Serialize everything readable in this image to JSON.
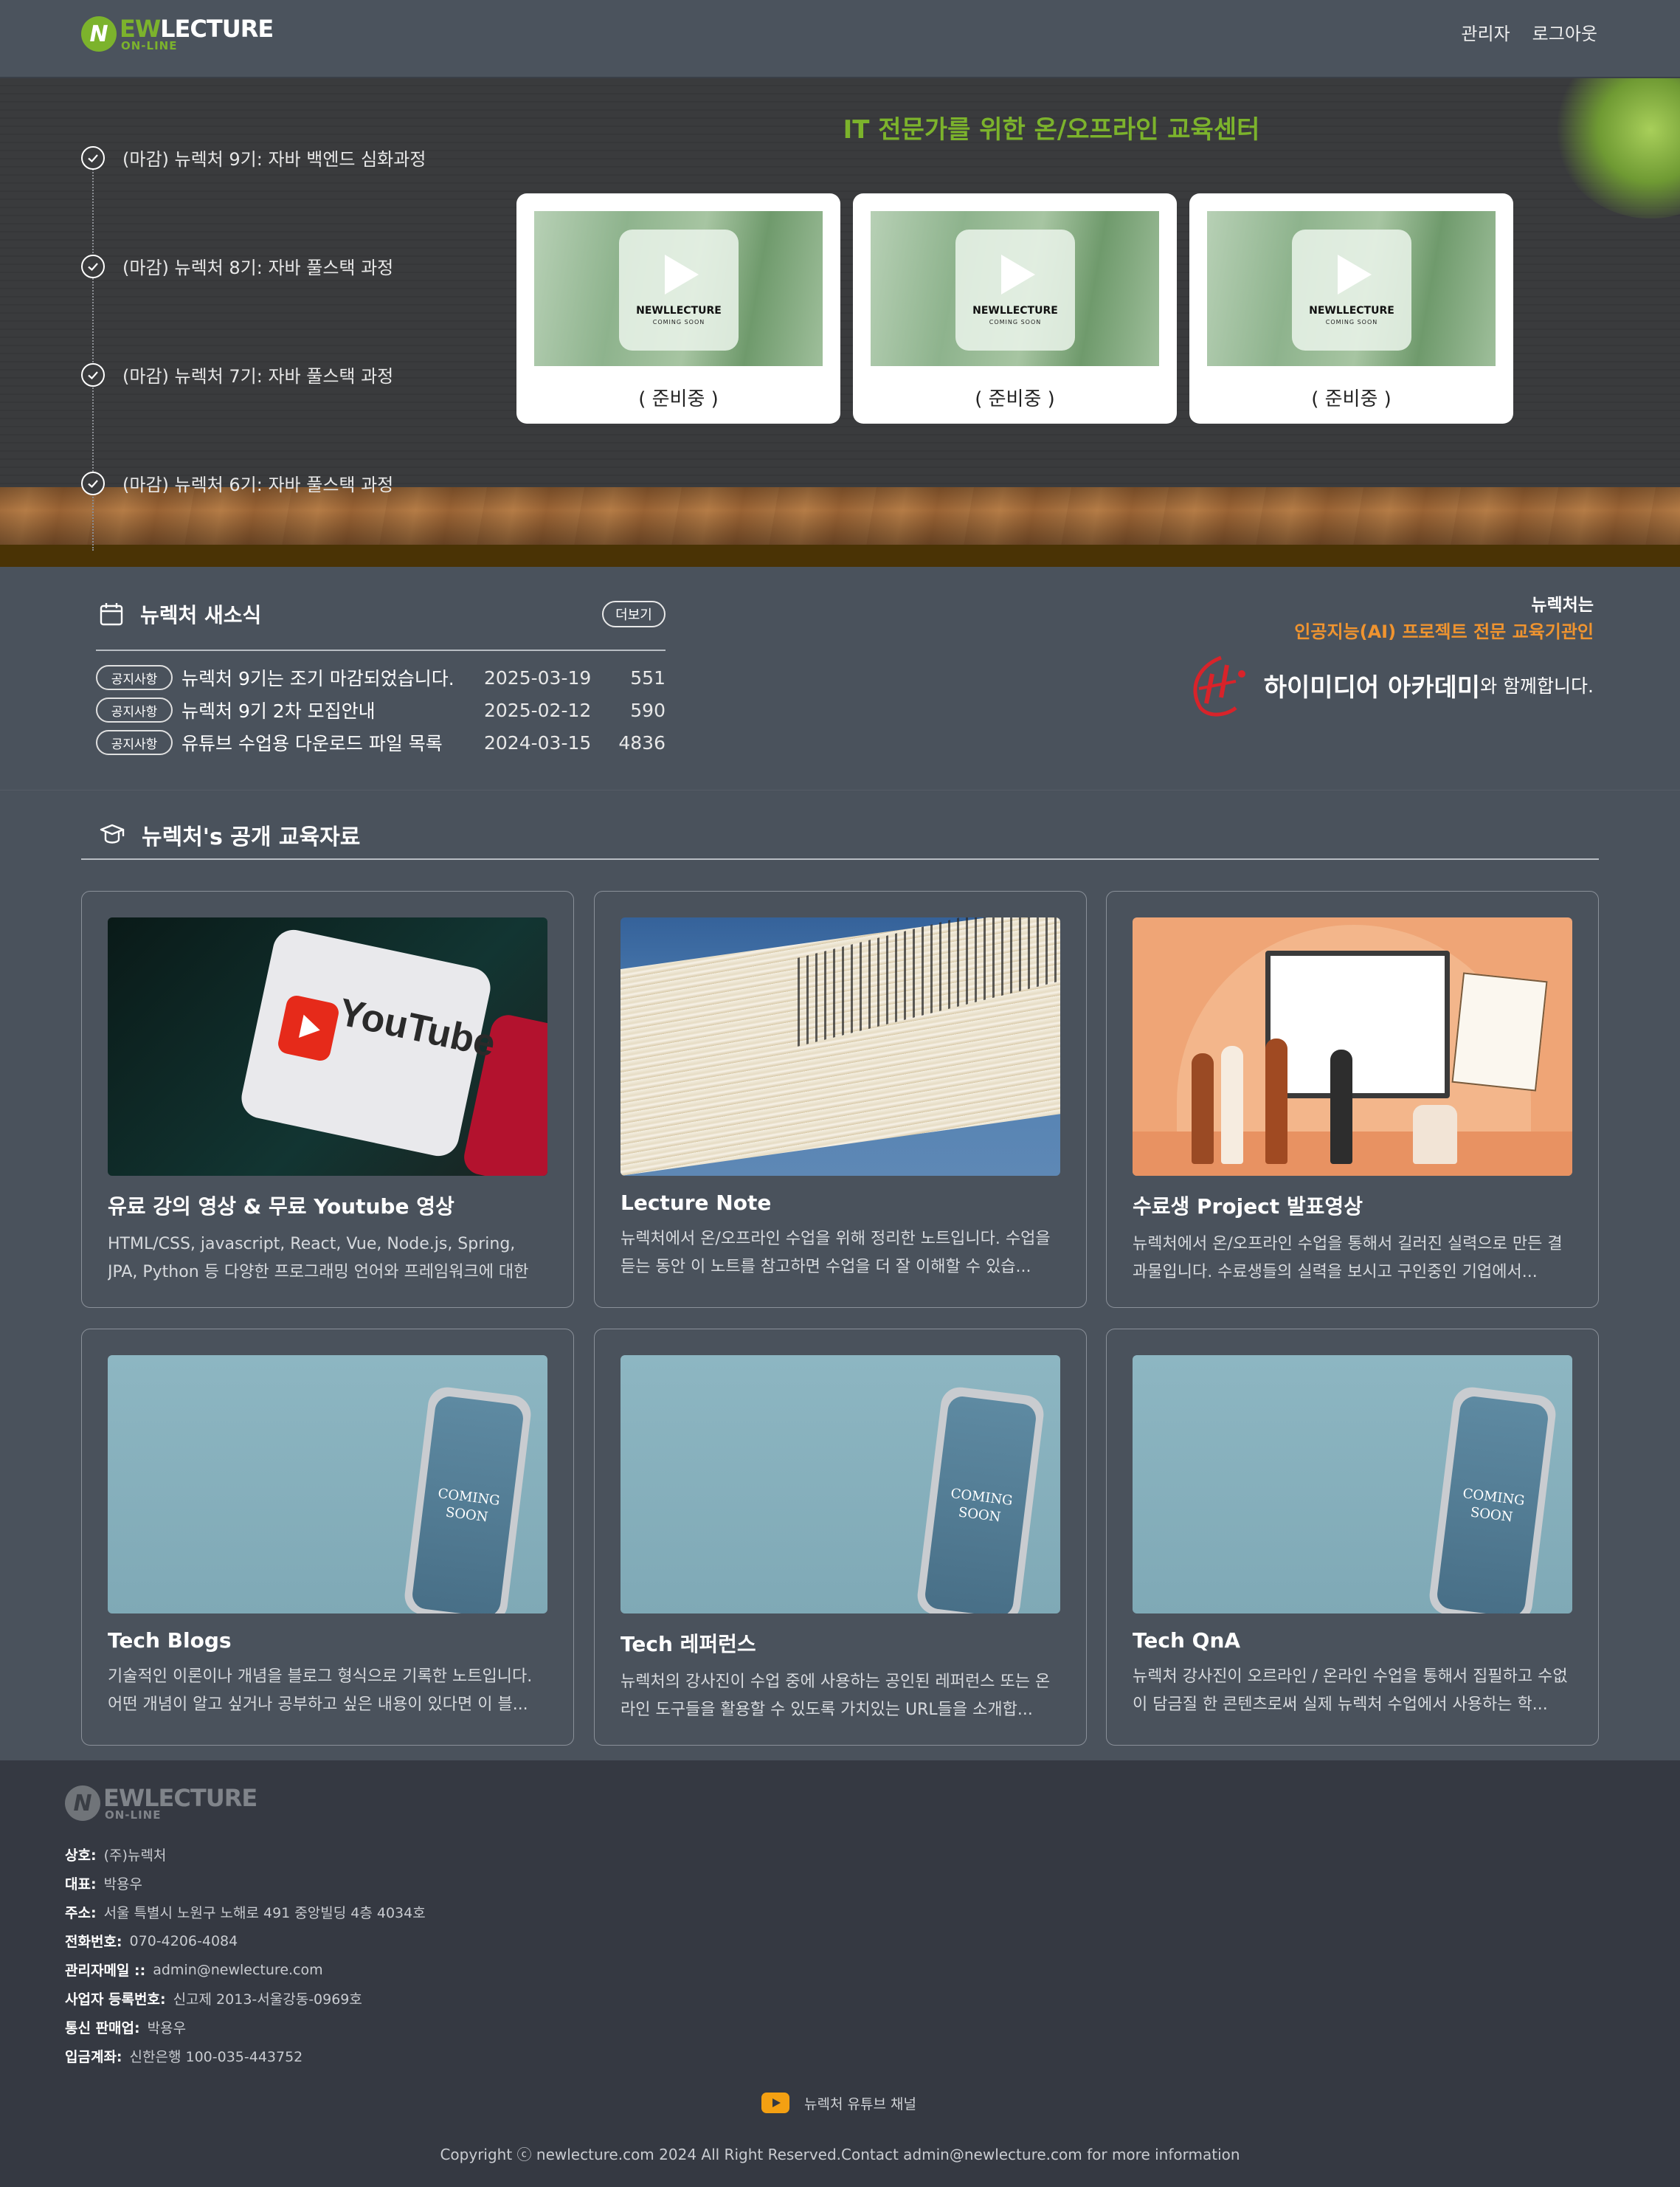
{
  "header": {
    "logo": {
      "mark": "N",
      "ew": "EW",
      "lec": "LECTURE",
      "sub": "ON-LINE"
    },
    "nav": [
      "관리자",
      "로그아웃"
    ]
  },
  "hero": {
    "title": "IT 전문가를 위한 온/오프라인 교육센터",
    "courses": [
      "(마감) 뉴렉처 9기: 자바 백엔드 심화과정",
      "(마감) 뉴렉처 8기: 자바 풀스택 과정",
      "(마감) 뉴렉처 7기: 자바 풀스택 과정",
      "(마감) 뉴렉처 6기: 자바 풀스택 과정"
    ],
    "videos": [
      {
        "brand": "NEWLLECTURE",
        "soon": "COMING SOON",
        "caption": "( 준비중 )"
      },
      {
        "brand": "NEWLLECTURE",
        "soon": "COMING SOON",
        "caption": "( 준비중 )"
      },
      {
        "brand": "NEWLLECTURE",
        "soon": "COMING SOON",
        "caption": "( 준비중 )"
      }
    ]
  },
  "news": {
    "title": "뉴렉처 새소식",
    "more": "더보기",
    "rows": [
      {
        "tag": "공지사항",
        "title": "뉴렉처 9기는 조기 마감되었습니다.",
        "date": "2025-03-19",
        "views": "551"
      },
      {
        "tag": "공지사항",
        "title": "뉴렉처 9기 2차 모집안내",
        "date": "2025-02-12",
        "views": "590"
      },
      {
        "tag": "공지사항",
        "title": "유튜브 수업용 다운로드 파일 목록",
        "date": "2024-03-15",
        "views": "4836"
      }
    ]
  },
  "partner": {
    "line1": "뉴렉처는",
    "line2": "인공지능(AI) 프로젝트 전문 교육기관인",
    "name": "하이미디어 아카데미",
    "suffix": "와 함께합니다."
  },
  "materials": {
    "title": "뉴렉처's 공개 교육자료",
    "items": [
      {
        "title": "유료 강의 영상 & 무료 Youtube 영상",
        "desc": "HTML/CSS, javascript, React, Vue, Node.js, Spring, JPA, Python 등 다양한 프로그래밍 언어와 프레임워크에 대한 강...",
        "image": "youtube"
      },
      {
        "title": "Lecture Note",
        "desc": "뉴렉처에서 온/오프라인 수업을 위해 정리한 노트입니다. 수업을 듣는 동안 이 노트를 참고하면 수업을 더 잘 이해할 수 있습...",
        "image": "notebooks"
      },
      {
        "title": "수료생 Project 발표영상",
        "desc": "뉴렉처에서 온/오프라인 수업을 통해서 길러진 실력으로 만든 결과물입니다. 수료생들의 실력을 보시고 구인중인 기업에서...",
        "image": "presentation"
      },
      {
        "title": "Tech Blogs",
        "desc": "기술적인 이론이나 개념을 블로그 형식으로 기록한 노트입니다. 어떤 개념이 알고 싶거나 공부하고 싶은 내용이 있다면 이 블...",
        "image": "coming-soon"
      },
      {
        "title": "Tech 레퍼런스",
        "desc": "뉴렉처의 강사진이 수업 중에 사용하는 공인된 레퍼런스 또는 온라인 도구들을 활용할 수 있도록 가치있는 URL들을 소개합...",
        "image": "coming-soon"
      },
      {
        "title": "Tech QnA",
        "desc": "뉴렉처 강사진이 오르라인 / 온라인 수업을 통해서 집필하고 수없이 담금질 한 콘텐츠로써 실제 뉴렉처 수업에서 사용하는 학...",
        "image": "coming-soon"
      }
    ],
    "phone_text": [
      "COMING",
      "SOON"
    ]
  },
  "footer": {
    "info": [
      {
        "k": "상호:",
        "v": "(주)뉴렉처"
      },
      {
        "k": "대표:",
        "v": "박용우"
      },
      {
        "k": "주소:",
        "v": "서울 특별시 노원구 노해로 491 중앙빌딩 4층 4034호"
      },
      {
        "k": "전화번호:",
        "v": "070-4206-4084"
      },
      {
        "k": "관리자메일 ::",
        "v": "admin@newlecture.com"
      },
      {
        "k": "사업자 등록번호:",
        "v": "신고제 2013-서울강동-0969호"
      },
      {
        "k": "통신 판매업:",
        "v": "박용우"
      },
      {
        "k": "입금계좌:",
        "v": "신한은행 100-035-443752"
      }
    ],
    "youtube": "뉴렉처 유튜브 채널",
    "copyright": "Copyright ⓒ newlecture.com 2024 All Right Reserved.Contact admin@newlecture.com for more information"
  },
  "colors": {
    "accent": "#7cb32c",
    "partner": "#f0942f",
    "bg": "#4a525c",
    "footer": "#353942"
  }
}
